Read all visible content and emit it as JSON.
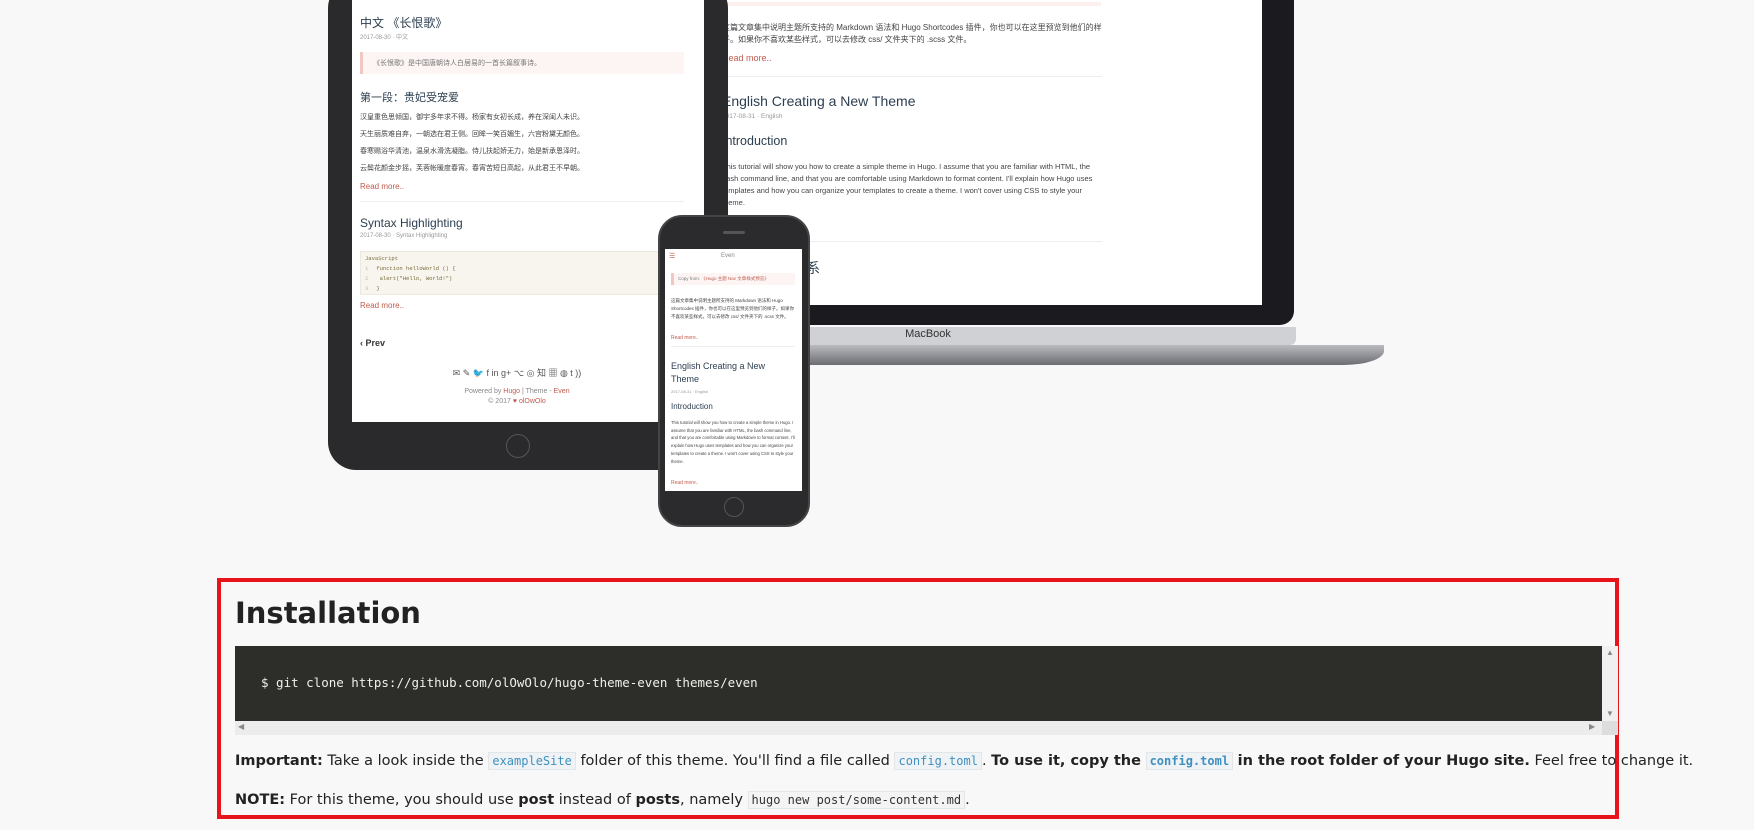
{
  "showcase": {
    "laptop": {
      "brand": "MacBook",
      "intro_text_1": "这篇文章集中说明主题所支持的 Markdown 语法和 Hugo Shortcodes 插件，你也可以在这里预览到他们的样",
      "intro_text_2": "子。如果你不喜欢某些样式，可以去修改 css/ 文件夹下的 .scss 文件。",
      "read_more": "Read more..",
      "post_title": "English Creating a New Theme",
      "post_meta": "2017-08-31 · English",
      "section_heading": "Introduction",
      "post_excerpt_1": "This tutorial will show you how to create a simple theme in Hugo. I assume that you are familiar with HTML, the",
      "post_excerpt_2": "bash command line, and that you are comfortable using Markdown to format content. I'll explain how Hugo uses",
      "post_excerpt_3": "templates and how you can organize your templates to create a theme. I won't cover using CSS to style your",
      "post_excerpt_4": "theme.",
      "next_title_partial": "系"
    },
    "tablet": {
      "post_title": "中文 《长恨歌》",
      "post_meta": "2017-08-30 · 中文",
      "quote": "《长恨歌》是中国唐朝诗人白居易的一首长篇叙事诗。",
      "section_heading": "第一段：贵妃受宠爱",
      "lines": [
        "汉皇重色思倾国，御宇多年求不得。杨家有女初长成，养在深闺人未识。",
        "天生丽质难自弃，一朝选在君王侧。回眸一笑百媚生，六宫粉黛无颜色。",
        "春寒赐浴华清池，温泉水滑洗凝脂。侍儿扶起娇无力，始是新承恩泽时。",
        "云鬓花颜金步摇，芙蓉帐暖度春宵。春宵苦短日高起，从此君王不早朝。"
      ],
      "read_more": "Read more..",
      "post2_title": "Syntax Highlighting",
      "post2_meta": "2017-08-30 · Syntax Highlighting",
      "code_lang": "JavaScript",
      "code_lines": [
        {
          "num": "1",
          "text": "function helloWorld () {"
        },
        {
          "num": "2",
          "text": "  alert(\"Hello, World!\")"
        },
        {
          "num": "3",
          "text": "}"
        }
      ],
      "read_more_2": "Read more..",
      "prev_label": "Prev",
      "social_icons": "✉ ✎ 🐦 f in g+ ⌥ ◎ 知 ▦ ◍ t ))",
      "footer_powered_prefix": "Powered by",
      "footer_hugo": "Hugo",
      "footer_theme_sep": "| Theme -",
      "footer_theme": "Even",
      "footer_copyright": "© 2017",
      "footer_heart": "♥",
      "footer_author": "olOwOlo"
    },
    "phone": {
      "logo": "Even",
      "menu_icon": "☰",
      "copy_notice_label": "Copy from:",
      "copy_notice_link": "《Hugo 主题 Nav 文章样式预览》",
      "intro_text": "这篇文章集中说明主题所支持的 Markdown 语法和 Hugo Shortcodes 插件，你也可以在这里预览到他们的样子。如果你不喜欢某些样式，可以去修改 css/ 文件夹下的 .scss 文件。",
      "read_more": "Read more..",
      "post_title": "English Creating a New Theme",
      "post_meta": "2017-08-31 · English",
      "section_heading": "Introduction",
      "excerpt": "This tutorial will show you how to create a simple theme in Hugo. I assume that you are familiar with HTML, the bash command line, and that you are comfortable using Markdown to format content. I'll explain how Hugo uses templates and how you can organize your templates to create a theme. I won't cover using CSS to style your theme.",
      "read_more_2": "Read more.."
    }
  },
  "installation": {
    "heading": "Installation",
    "command": "$ git clone https://github.com/olOwOlo/hugo-theme-even themes/even",
    "scroll_up": "▲",
    "scroll_down": "▼",
    "scroll_left": "◀",
    "scroll_right": "▶",
    "important": {
      "label": "Important:",
      "t1": "Take a look inside the",
      "code1": "exampleSite",
      "t2": "folder of this theme. You'll find a file called",
      "code2": "config.toml",
      "t3": ".",
      "bold1": "To use it, copy the",
      "code3": "config.toml",
      "bold2": "in the root folder of your Hugo site.",
      "t4": "Feel free to change it."
    },
    "note": {
      "label": "NOTE:",
      "t1": "For this theme, you should use",
      "b1": "post",
      "t2": "instead of",
      "b2": "posts",
      "t3": ", namely",
      "code": "hugo new post/some-content.md",
      "t4": "."
    }
  }
}
